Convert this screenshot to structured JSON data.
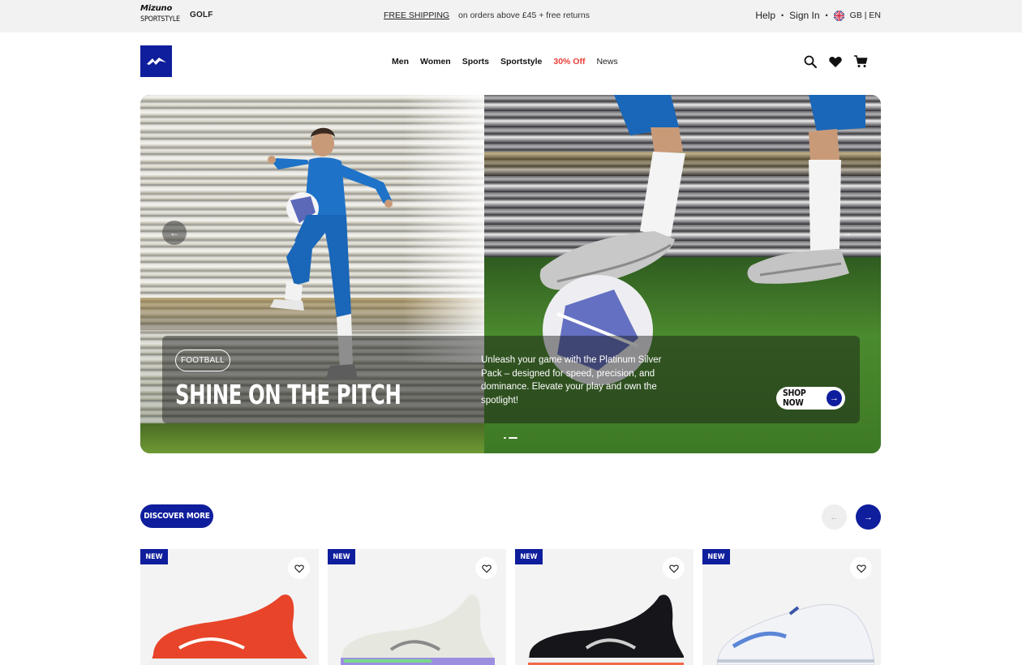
{
  "topbar": {
    "brand_logo": "Mizuno",
    "brand_sub": "SPORTSTYLE",
    "golf": "GOLF",
    "shipping_link": "FREE SHIPPING",
    "shipping_text": "on orders above £45 + free returns",
    "help": "Help",
    "sign_in": "Sign In",
    "separator": "•",
    "locale": "GB | EN"
  },
  "nav": {
    "items": [
      "Men",
      "Women",
      "Sports",
      "Sportstyle",
      "30% Off",
      "News"
    ]
  },
  "hero": {
    "tag": "FOOTBALL",
    "headline": "SHINE ON THE PITCH",
    "description": "Unleash your game with the Platinum Silver Pack – designed for speed, precision, and dominance. Elevate your play and own the spotlight!",
    "cta": "SHOP NOW",
    "slide_index": 2,
    "slide_count": 2
  },
  "discover": {
    "label": "DISCOVER MORE"
  },
  "products": [
    {
      "badge": "NEW",
      "color": "#e8442a"
    },
    {
      "badge": "NEW",
      "color": "#e6e8e0"
    },
    {
      "badge": "NEW",
      "color": "#15151a"
    },
    {
      "badge": "NEW",
      "color": "#f2f3f7"
    }
  ],
  "colors": {
    "brand_blue": "#0f1e9c",
    "sale_red": "#e8403a"
  }
}
